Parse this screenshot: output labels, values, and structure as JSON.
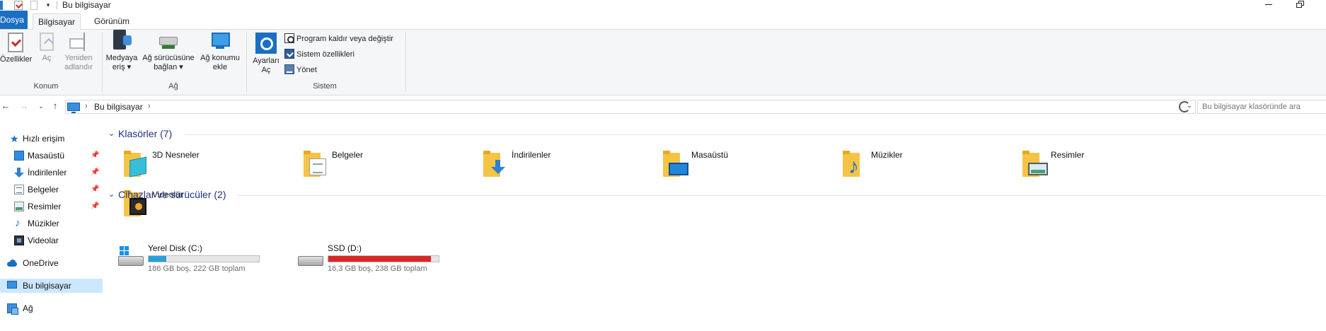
{
  "window": {
    "title": "Bu bilgisayar"
  },
  "ribbon": {
    "tabs": {
      "file": "Dosya",
      "computer": "Bilgisayar",
      "view": "Görünüm"
    },
    "groups": {
      "location": {
        "label": "Konum",
        "properties": "Özellikler",
        "open": "Aç",
        "rename_line1": "Yeniden",
        "rename_line2": "adlandır"
      },
      "network": {
        "label": "Ağ",
        "media_line1": "Medyaya",
        "media_line2": "eriş",
        "mapdrive_line1": "Ağ sürücüsüne",
        "mapdrive_line2": "bağlan",
        "addloc_line1": "Ağ konumu",
        "addloc_line2": "ekle"
      },
      "system": {
        "label": "Sistem",
        "settings_line1": "Ayarları",
        "settings_line2": "Aç",
        "uninstall": "Program kaldır veya değiştir",
        "sysprops": "Sistem özellikleri",
        "manage": "Yönet"
      }
    }
  },
  "address": {
    "crumb": "Bu bilgisayar",
    "search_placeholder": "Bu bilgisayar klasöründe ara"
  },
  "navpane": {
    "quick_access": "Hızlı erişim",
    "items": [
      {
        "label": "Masaüstü",
        "pinned": true
      },
      {
        "label": "İndirilenler",
        "pinned": true
      },
      {
        "label": "Belgeler",
        "pinned": true
      },
      {
        "label": "Resimler",
        "pinned": true
      },
      {
        "label": "Müzikler",
        "pinned": false
      },
      {
        "label": "Videolar",
        "pinned": false
      }
    ],
    "onedrive": "OneDrive",
    "this_pc": "Bu bilgisayar",
    "network": "Ağ"
  },
  "main": {
    "folders_header": "Klasörler (7)",
    "folders": [
      {
        "label": "3D Nesneler",
        "icon": "3d-objects-folder-icon"
      },
      {
        "label": "Belgeler",
        "icon": "documents-folder-icon"
      },
      {
        "label": "İndirilenler",
        "icon": "downloads-folder-icon"
      },
      {
        "label": "Masaüstü",
        "icon": "desktop-folder-icon"
      },
      {
        "label": "Müzikler",
        "icon": "music-folder-icon"
      },
      {
        "label": "Resimler",
        "icon": "pictures-folder-icon"
      },
      {
        "label": "Videolar",
        "icon": "videos-folder-icon"
      }
    ],
    "devices_header": "Cihazlar ve sürücüler (2)",
    "drives": [
      {
        "name": "Yerel Disk (C:)",
        "info": "186 GB boş, 222 GB toplam",
        "used_fraction": 0.16,
        "bar_color": "#26a0da"
      },
      {
        "name": "SSD (D:)",
        "info": "16,3 GB boş, 238 GB toplam",
        "used_fraction": 0.93,
        "bar_color": "#da2626"
      }
    ]
  },
  "colors": {
    "accent": "#1a6fc2",
    "group_header": "#1e3287",
    "selection": "#cce8ff"
  }
}
